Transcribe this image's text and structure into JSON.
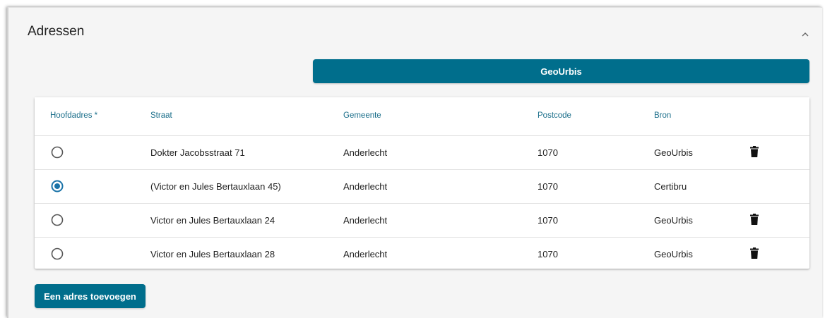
{
  "panel": {
    "title": "Adressen",
    "collapse_icon": "chevron-up-icon"
  },
  "geourbis_button": {
    "label": "GeoUrbis"
  },
  "table": {
    "headers": {
      "main": "Hoofdadres *",
      "street": "Straat",
      "municipality": "Gemeente",
      "postcode": "Postcode",
      "source": "Bron"
    },
    "rows": [
      {
        "selected": false,
        "street": "Dokter Jacobsstraat 71",
        "municipality": "Anderlecht",
        "postcode": "1070",
        "source": "GeoUrbis",
        "deletable": true
      },
      {
        "selected": true,
        "street": "(Victor en Jules Bertauxlaan 45)",
        "municipality": "Anderlecht",
        "postcode": "1070",
        "source": "Certibru",
        "deletable": false
      },
      {
        "selected": false,
        "street": "Victor en Jules Bertauxlaan 24",
        "municipality": "Anderlecht",
        "postcode": "1070",
        "source": "GeoUrbis",
        "deletable": true
      },
      {
        "selected": false,
        "street": "Victor en Jules Bertauxlaan 28",
        "municipality": "Anderlecht",
        "postcode": "1070",
        "source": "GeoUrbis",
        "deletable": true
      }
    ]
  },
  "add_button": {
    "label": "Een adres toevoegen"
  },
  "colors": {
    "primary": "#006e8c",
    "header_text": "#1a6e8a",
    "radio_selected": "#1a73a8",
    "radio_unselected": "#555555"
  }
}
